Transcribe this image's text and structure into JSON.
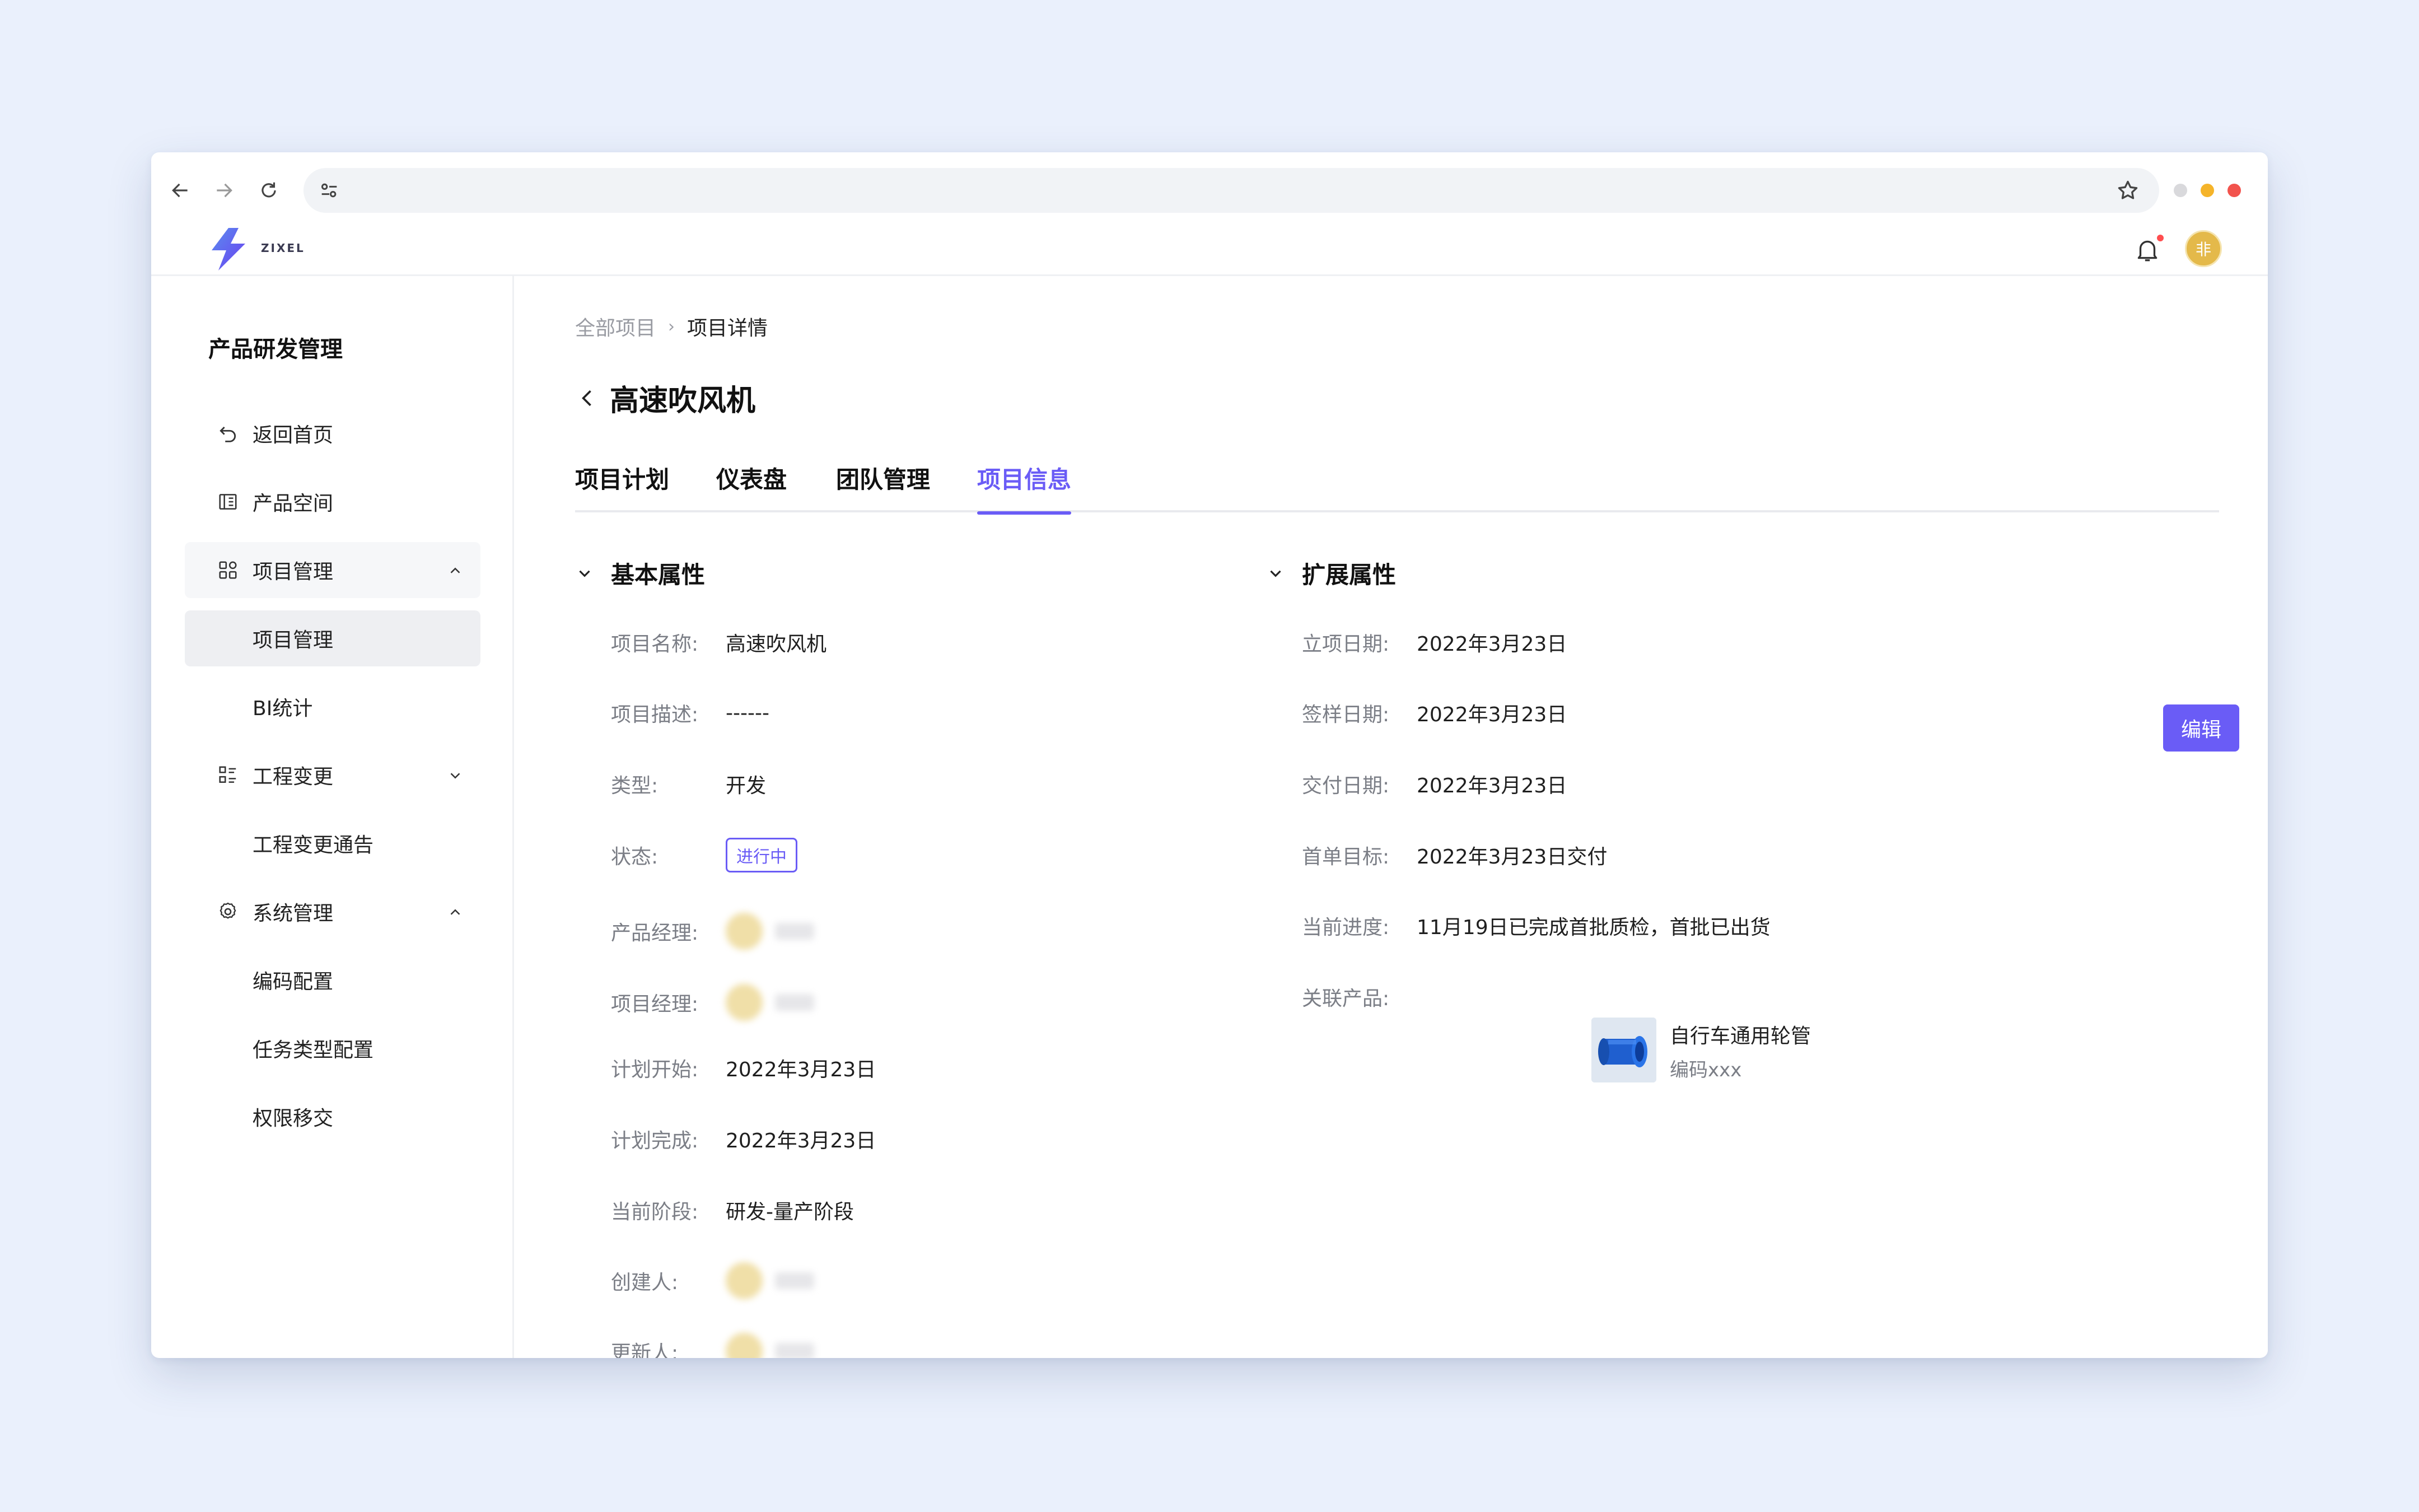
{
  "app": {
    "logo_text": "ZIXEL",
    "user_initial": "非"
  },
  "sidebar": {
    "title": "产品研发管理",
    "items": [
      {
        "label": "返回首页"
      },
      {
        "label": "产品空间"
      },
      {
        "label": "项目管理"
      },
      {
        "label": "项目管理"
      },
      {
        "label": "BI统计"
      },
      {
        "label": "工程变更"
      },
      {
        "label": "工程变更通告"
      },
      {
        "label": "系统管理"
      },
      {
        "label": "编码配置"
      },
      {
        "label": "任务类型配置"
      },
      {
        "label": "权限移交"
      }
    ]
  },
  "breadcrumb": {
    "root": "全部项目",
    "current": "项目详情"
  },
  "page": {
    "title": "高速吹风机"
  },
  "tabs": [
    {
      "label": "项目计划"
    },
    {
      "label": "仪表盘"
    },
    {
      "label": "团队管理"
    },
    {
      "label": "项目信息"
    }
  ],
  "basic": {
    "heading": "基本属性",
    "fields": [
      {
        "label": "项目名称:",
        "value": "高速吹风机"
      },
      {
        "label": "项目描述:",
        "value": "------"
      },
      {
        "label": "类型:",
        "value": "开发"
      },
      {
        "label": "状态:",
        "value": "进行中"
      },
      {
        "label": "产品经理:",
        "value": ""
      },
      {
        "label": "项目经理:",
        "value": ""
      },
      {
        "label": "计划开始:",
        "value": "2022年3月23日"
      },
      {
        "label": "计划完成:",
        "value": "2022年3月23日"
      },
      {
        "label": "当前阶段:",
        "value": "研发-量产阶段"
      },
      {
        "label": "创建人:",
        "value": ""
      },
      {
        "label": "更新人:",
        "value": ""
      }
    ]
  },
  "extended": {
    "heading": "扩展属性",
    "edit_label": "编辑",
    "fields": [
      {
        "label": "立项日期:",
        "value": "2022年3月23日"
      },
      {
        "label": "签样日期:",
        "value": "2022年3月23日"
      },
      {
        "label": "交付日期:",
        "value": "2022年3月23日"
      },
      {
        "label": "首单目标:",
        "value": "2022年3月23日交付"
      },
      {
        "label": "当前进度:",
        "value": "11月19日已完成首批质检，首批已出货"
      },
      {
        "label": "关联产品:",
        "value": ""
      }
    ],
    "product": {
      "name": "自行车通用轮管",
      "code": "编码xxx"
    }
  },
  "colors": {
    "accent": "#6a5cf6",
    "background": "#eaf0fc"
  }
}
